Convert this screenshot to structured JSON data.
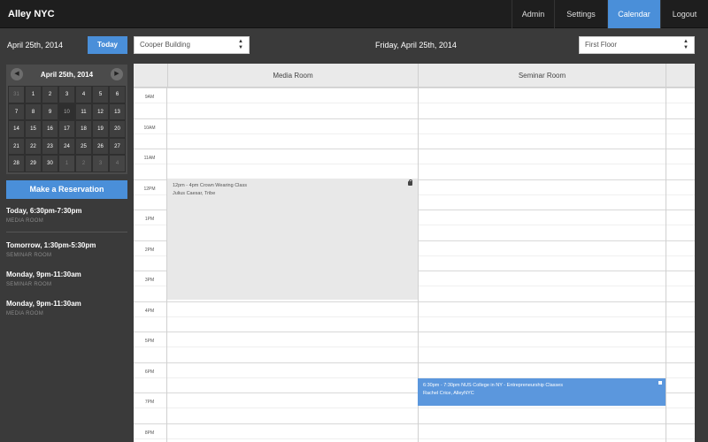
{
  "app": {
    "title": "Alley NYC"
  },
  "nav": {
    "items": [
      {
        "label": "Admin"
      },
      {
        "label": "Settings"
      },
      {
        "label": "Calendar",
        "active": true
      },
      {
        "label": "Logout"
      }
    ]
  },
  "sidebar": {
    "current_date": "April 25th, 2014",
    "today_label": "Today",
    "calendar": {
      "title": "April 25th, 2014",
      "prev_icon": "chevron-left-icon",
      "next_icon": "chevron-right-icon",
      "selected_day": "10",
      "weeks": [
        [
          "31",
          "1",
          "2",
          "3",
          "4",
          "5",
          "6"
        ],
        [
          "7",
          "8",
          "9",
          "10",
          "11",
          "12",
          "13"
        ],
        [
          "14",
          "15",
          "16",
          "17",
          "18",
          "19",
          "20"
        ],
        [
          "21",
          "22",
          "23",
          "24",
          "25",
          "26",
          "27"
        ],
        [
          "28",
          "29",
          "30",
          "1",
          "2",
          "3",
          "4"
        ]
      ]
    },
    "reserve_label": "Make a Reservation",
    "reservations": [
      {
        "time": "Today, 6:30pm-7:30pm",
        "room": "MEDIA ROOM"
      },
      {
        "time": "Tomorrow, 1:30pm-5:30pm",
        "room": "SEMINAR ROOM"
      },
      {
        "time": "Monday, 9pm-11:30am",
        "room": "SEMINAR ROOM"
      },
      {
        "time": "Monday, 9pm-11:30am",
        "room": "MEDIA ROOM"
      }
    ]
  },
  "controls": {
    "building": "Cooper Building",
    "heading_date": "Friday, April 25th, 2014",
    "floor": "First Floor"
  },
  "schedule": {
    "columns": [
      "Media Room",
      "Seminar Room"
    ],
    "hours": [
      "9AM",
      "10AM",
      "11AM",
      "12PM",
      "1PM",
      "2PM",
      "3PM",
      "4PM",
      "5PM",
      "6PM",
      "7PM",
      "8PM"
    ],
    "events": [
      {
        "line1": "12pm - 4pm Crown Wearing Class",
        "line2": "Julius Caesar, Tribe",
        "color": "#e8e8e8",
        "icon": "lock-icon"
      },
      {
        "line1": "6:30pm - 7:30pm NUS College in NY - Entrepreneurship Classes",
        "line2": "Rachel Crice, AlleyNYC",
        "color": "#5b97dd"
      }
    ]
  },
  "colors": {
    "accent": "#4a8fd9",
    "topbar": "#1e1e1e",
    "sidebar": "#3a3a3a"
  }
}
